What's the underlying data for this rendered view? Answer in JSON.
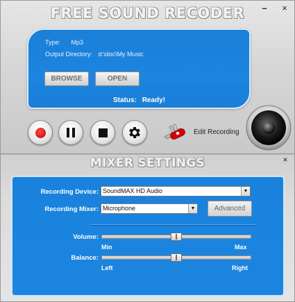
{
  "window": {
    "title": "FREE SOUND RECODER",
    "minimize_symbol": "–",
    "close_symbol": "×"
  },
  "info": {
    "type_label": "Type:",
    "type_value": "Mp3",
    "output_dir_label": "Output Directory:",
    "output_dir_value": "d:\\doc\\My Music",
    "browse_label": "BROWSE",
    "open_label": "OPEN",
    "status_label": "Status:",
    "status_value": "Ready!"
  },
  "controls": {
    "record_icon": "record-icon",
    "pause_icon": "pause-icon",
    "stop_icon": "stop-icon",
    "settings_icon": "gear-icon",
    "edit_label": "Edit Recording",
    "edit_icon": "swiss-knife-icon",
    "speaker_icon": "speaker-icon"
  },
  "mixer": {
    "title": "MIXER SETTINGS",
    "close_symbol": "×",
    "device_label": "Recording Device:",
    "device_value": "SoundMAX HD Audio",
    "mixer_label": "Recording Mixer:",
    "mixer_value": "Microphone",
    "advanced_label": "Advanced",
    "volume_label": "Volume:",
    "volume_value": 0.5,
    "volume_min_label": "Min",
    "volume_max_label": "Max",
    "balance_label": "Balance:",
    "balance_value": 0.5,
    "balance_left_label": "Left",
    "balance_right_label": "Right",
    "dropdown_arrow": "▼"
  },
  "colors": {
    "panel_blue": "#1b85e0",
    "record_red": "#d00000",
    "chrome_gray": "#d6d6d6"
  }
}
